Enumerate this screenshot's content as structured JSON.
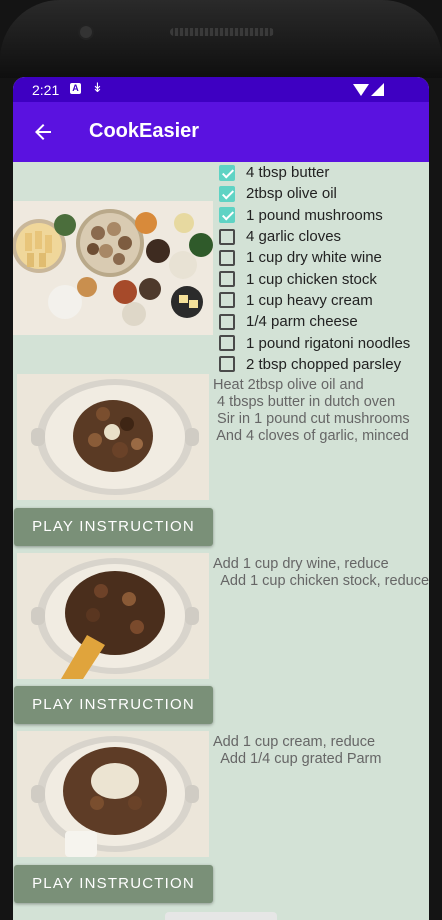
{
  "status_bar": {
    "time": "2:21",
    "notif_letter": "A"
  },
  "app_bar": {
    "title": "CookEasier"
  },
  "ingredients": [
    {
      "label": "4 tbsp butter",
      "checked": true
    },
    {
      "label": "2tbsp olive oil",
      "checked": true
    },
    {
      "label": "1 pound mushrooms",
      "checked": true
    },
    {
      "label": "4 garlic cloves",
      "checked": false
    },
    {
      "label": "1 cup dry white wine",
      "checked": false
    },
    {
      "label": "1 cup chicken stock",
      "checked": false
    },
    {
      "label": "1 cup heavy cream",
      "checked": false
    },
    {
      "label": "1/4 parm cheese",
      "checked": false
    },
    {
      "label": "1 pound rigatoni noodles",
      "checked": false
    },
    {
      "label": "2 tbsp chopped parsley",
      "checked": false
    }
  ],
  "steps": [
    {
      "text": "Heat 2tbsp olive oil and\n 4 tbsps butter in dutch oven\n Sir in 1 pound cut mushrooms\n And 4 cloves of garlic, minced",
      "button": "PLAY INSTRUCTION"
    },
    {
      "text": "Add 1 cup dry wine, reduce\n  Add 1 cup chicken stock, reduce",
      "button": "PLAY INSTRUCTION"
    },
    {
      "text": "Add 1 cup cream, reduce\n  Add 1/4 cup grated Parm",
      "button": "PLAY INSTRUCTION"
    }
  ],
  "colors": {
    "status_bar": "#3e00c2",
    "app_bar": "#5a12e0",
    "background": "#d3e2d6",
    "button": "#7a9078",
    "checkbox": "#5fd3c4"
  }
}
